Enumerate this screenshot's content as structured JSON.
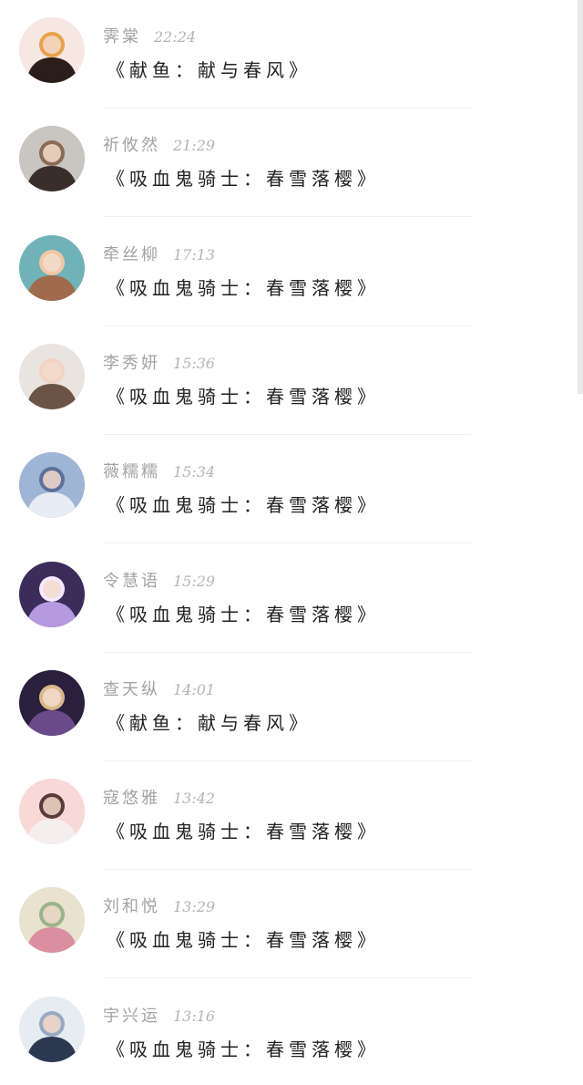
{
  "comments": [
    {
      "name": "霁棠",
      "time": "22:24",
      "message": "《献鱼：献与春风》",
      "avatar_icon": "avatar-girl-cartoon-icon",
      "avatar_colors": [
        "#f7e7e2",
        "#2a1d1a",
        "#e8a24a"
      ]
    },
    {
      "name": "祈攸然",
      "time": "21:29",
      "message": "《吸血鬼骑士：春雪落樱》",
      "avatar_icon": "avatar-photo-dark-icon",
      "avatar_colors": [
        "#c9c5c0",
        "#3a2e2a",
        "#8a6b55"
      ]
    },
    {
      "name": "牵丝柳",
      "time": "17:13",
      "message": "《吸血鬼骑士：春雪落樱》",
      "avatar_icon": "avatar-child-photo-icon",
      "avatar_colors": [
        "#6fb3b8",
        "#a06a4c",
        "#f2c7a5"
      ]
    },
    {
      "name": "李秀妍",
      "time": "15:36",
      "message": "《吸血鬼骑士：春雪落樱》",
      "avatar_icon": "avatar-woman-photo-icon",
      "avatar_colors": [
        "#e9e4df",
        "#6b5446",
        "#f1d3c4"
      ]
    },
    {
      "name": "薇糯糯",
      "time": "15:34",
      "message": "《吸血鬼骑士：春雪落樱》",
      "avatar_icon": "avatar-anime-blue-icon",
      "avatar_colors": [
        "#9fb5d6",
        "#e8ecf5",
        "#5d6f9a"
      ]
    },
    {
      "name": "令慧语",
      "time": "15:29",
      "message": "《吸血鬼骑士：春雪落樱》",
      "avatar_icon": "avatar-anime-purple-icon",
      "avatar_colors": [
        "#3b2c5a",
        "#b59ae0",
        "#f5e9ff"
      ]
    },
    {
      "name": "查天纵",
      "time": "14:01",
      "message": "《献鱼：献与春风》",
      "avatar_icon": "avatar-anime-dark-icon",
      "avatar_colors": [
        "#2a1f3d",
        "#6b4a8a",
        "#d9b98c"
      ]
    },
    {
      "name": "寇悠雅",
      "time": "13:42",
      "message": "《吸血鬼骑士：春雪落樱》",
      "avatar_icon": "avatar-pink-blob-icon",
      "avatar_colors": [
        "#f9d8d8",
        "#f5eeee",
        "#5a3a3a"
      ]
    },
    {
      "name": "刘和悦",
      "time": "13:29",
      "message": "《吸血鬼骑士：春雪落樱》",
      "avatar_icon": "avatar-book-photo-icon",
      "avatar_colors": [
        "#e8e2cf",
        "#d98fa0",
        "#9bb38a"
      ]
    },
    {
      "name": "宇兴运",
      "time": "13:16",
      "message": "《吸血鬼骑士：春雪落樱》",
      "avatar_icon": "avatar-anime-room-icon",
      "avatar_colors": [
        "#e7ecf2",
        "#2c3850",
        "#9aa9c2"
      ]
    }
  ]
}
